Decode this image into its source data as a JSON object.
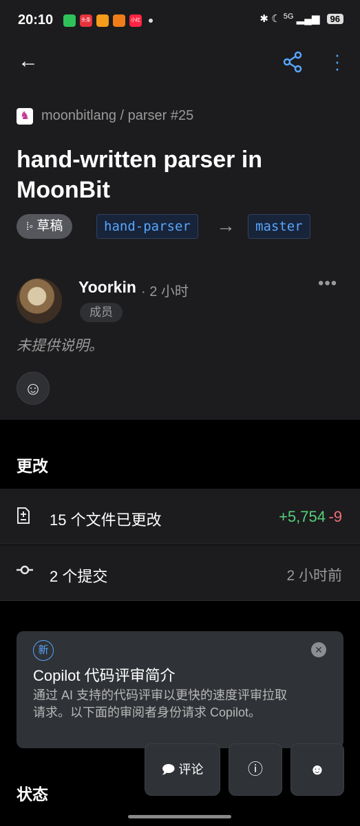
{
  "status_bar": {
    "time": "20:10",
    "apps": [
      {
        "name": "wechat-icon",
        "color": "#2fc25b",
        "text": ""
      },
      {
        "name": "toutiao-icon",
        "color": "#e8333c",
        "text": "头条"
      },
      {
        "name": "app-icon",
        "color": "#f59c1a",
        "text": ""
      },
      {
        "name": "app-icon-2",
        "color": "#ef7d19",
        "text": ""
      },
      {
        "name": "xiaohongshu-icon",
        "color": "#ff2442",
        "text": "小红书"
      }
    ],
    "network": "5G",
    "battery": "96"
  },
  "header": {
    "icons": [
      "back-arrow-icon",
      "share-icon",
      "more-vertical-icon"
    ]
  },
  "pr": {
    "repo": "moonbitlang / parser #25",
    "title": "hand-written parser in MoonBit",
    "state": "草稿",
    "head_branch": "hand-parser",
    "base_branch": "master"
  },
  "comment": {
    "author": "Yoorkin",
    "ago": "· 2 小时",
    "role": "成员",
    "body": "未提供说明。"
  },
  "changes": {
    "title": "更改",
    "files_label": "15 个文件已更改",
    "additions": "+5,754",
    "deletions": "-9",
    "commits_label": "2 个提交",
    "commits_ago": "2 小时前"
  },
  "copilot_card": {
    "badge": "新",
    "title": "Copilot 代码评审简介",
    "body": "通过 AI 支持的代码评审以更快的速度评审拉取请求。以下面的审阅者身份请求 Copilot。"
  },
  "status_section": {
    "title": "状态"
  },
  "bottom_actions": {
    "comment_label": "评论"
  },
  "colors": {
    "accent": "#58a6ff",
    "additions": "#57d07a",
    "deletions": "#f2707a"
  }
}
